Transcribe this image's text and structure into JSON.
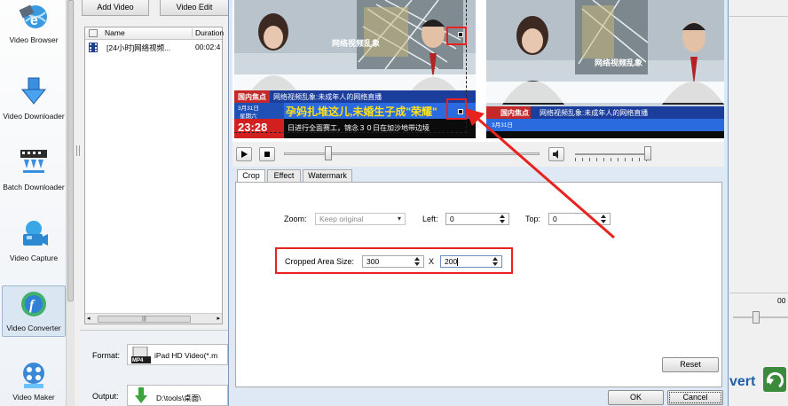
{
  "sidebar": {
    "items": [
      {
        "label": "Video Browser",
        "icon": "globe-film-icon"
      },
      {
        "label": "Video Downloader",
        "icon": "download-arrow-icon"
      },
      {
        "label": "Batch Downloader",
        "icon": "batch-download-icon"
      },
      {
        "label": "Video Capture",
        "icon": "camera-icon"
      },
      {
        "label": "Video Converter",
        "icon": "converter-icon"
      },
      {
        "label": "Video Maker",
        "icon": "film-reel-icon"
      }
    ]
  },
  "toolbar": {
    "add_video": "Add Video",
    "video_edit": "Video Edit"
  },
  "file_list": {
    "columns": [
      "Name",
      "Duration"
    ],
    "rows": [
      {
        "name": "[24小时]网络视频...",
        "duration": "00:02:4"
      }
    ],
    "scroll_grip": "|||"
  },
  "format": {
    "label": "Format:",
    "value": "iPad HD Video(*.m",
    "badge": "MP4"
  },
  "output": {
    "label": "Output:",
    "value": "D:\\tools\\桌面\\"
  },
  "right_fragments": {
    "convert_label": "vert",
    "number": "00"
  },
  "preview": {
    "left_frame": {
      "tv_banner": "网络视频乱象",
      "channel_tag": "国内焦点",
      "headline": "网络视频乱象:未成年人的网络直播",
      "ticker": "孕妈扎堆这儿,未婚生子成\"荣耀\"",
      "date_text": "3月31日",
      "weekday": "星期六",
      "time_text": "23:28",
      "scroll_text": "日进行全面赛工，锦念３０日在加沙地带边境"
    },
    "right_frame": {
      "tv_banner": "网络视频乱象",
      "channel_tag": "国内焦点",
      "headline": "网络视频乱象:未成年人的网络直播",
      "date_text": "3月31日"
    }
  },
  "crop_tabs": [
    {
      "label": "Crop",
      "active": true
    },
    {
      "label": "Effect",
      "active": false
    },
    {
      "label": "Watermark",
      "active": false
    }
  ],
  "crop": {
    "zoom_label": "Zoom:",
    "zoom_value": "Keep original",
    "left_label": "Left:",
    "left_value": "0",
    "top_label": "Top:",
    "top_value": "0",
    "area_label": "Cropped Area Size:",
    "width_value": "300",
    "x_label": "X",
    "height_value": "200"
  },
  "buttons": {
    "reset": "Reset",
    "ok": "OK",
    "cancel": "Cancel"
  },
  "colors": {
    "highlight": "#e8231f",
    "accent": "#1f5fa6"
  }
}
